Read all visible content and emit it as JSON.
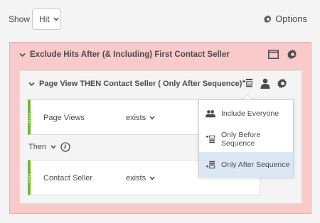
{
  "toolbar": {
    "show_label": "Show",
    "show_value": "Hit",
    "options_label": "Options"
  },
  "outer_container": {
    "title": "Exclude Hits After (& Including) First Contact Seller",
    "color": "#f9caca"
  },
  "inner_container": {
    "title": "Page View THEN Contact Seller ( Only After Sequence)"
  },
  "rules": [
    {
      "label": "Page Views",
      "operator": "exists"
    },
    {
      "label": "Contact Seller",
      "operator": "exists"
    }
  ],
  "then_label": "Then",
  "menu": {
    "items": [
      {
        "label": "Include Everyone",
        "icon": "people-icon"
      },
      {
        "label": "Only Before Sequence",
        "icon": "before-sequence-icon"
      },
      {
        "label": "Only After Sequence",
        "icon": "after-sequence-icon",
        "selected": true
      }
    ]
  },
  "colors": {
    "rule_accent": "#76b43b",
    "selected_item": "#dbe6f6"
  }
}
